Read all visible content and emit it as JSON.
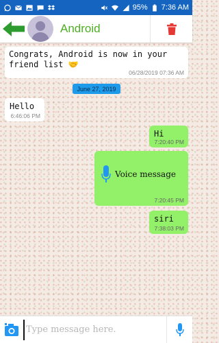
{
  "status_bar": {
    "battery": "95%",
    "time": "7:36 AM",
    "bg_color": "#1565c0",
    "left_icons": [
      "whatsapp-icon",
      "mail-icon",
      "image-icon",
      "sms-icon",
      "dropbox-icon"
    ],
    "right_icons": [
      "mute-icon",
      "wifi-icon",
      "signal-icon",
      "battery-icon"
    ]
  },
  "header": {
    "contact_name": "Android",
    "name_color": "#4caf22",
    "back_icon": "arrow-left-icon",
    "delete_icon": "trash-icon"
  },
  "messages": {
    "system": {
      "text": "Congrats, Android is now in your friend list",
      "emoji": "🤝",
      "time": "06/28/2019 07:36 AM"
    },
    "date_badge": "June 27, 2019",
    "hello": {
      "text": "Hello",
      "time": "6:46:06 PM",
      "direction": "incoming"
    },
    "hi": {
      "text": "Hi",
      "time": "7:20:40 PM",
      "direction": "outgoing"
    },
    "voice": {
      "text": "Voice message",
      "time": "7:20:45 PM",
      "direction": "outgoing",
      "icon": "microphone-icon"
    },
    "siri": {
      "text": "siri",
      "time": "7:38:03 PM",
      "direction": "outgoing"
    },
    "outgoing_color": "#92f069"
  },
  "input": {
    "placeholder": "Type message here.",
    "value": "",
    "camera_icon": "camera-icon",
    "mic_icon": "microphone-icon"
  }
}
